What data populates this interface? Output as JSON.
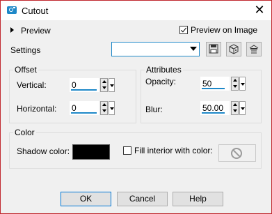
{
  "window": {
    "title": "Cutout"
  },
  "preview": {
    "toggle_label": "Preview",
    "on_image_label": "Preview on Image",
    "on_image_checked": true
  },
  "settings": {
    "label": "Settings",
    "preset_value": ""
  },
  "offset": {
    "title": "Offset",
    "vertical_label": "Vertical:",
    "vertical_value": "0",
    "horizontal_label": "Horizontal:",
    "horizontal_value": "0"
  },
  "attributes": {
    "title": "Attributes",
    "opacity_label": "Opacity:",
    "opacity_value": "50",
    "blur_label": "Blur:",
    "blur_value": "50.00"
  },
  "color": {
    "title": "Color",
    "shadow_label": "Shadow color:",
    "shadow_color": "#000000",
    "fill_label": "Fill interior with color:",
    "fill_checked": false
  },
  "buttons": {
    "ok": "OK",
    "cancel": "Cancel",
    "help": "Help"
  },
  "icons": [
    "camera-icon",
    "close-icon",
    "save-preset-icon",
    "reset-icon",
    "preset-options-icon",
    "no-color-icon"
  ]
}
